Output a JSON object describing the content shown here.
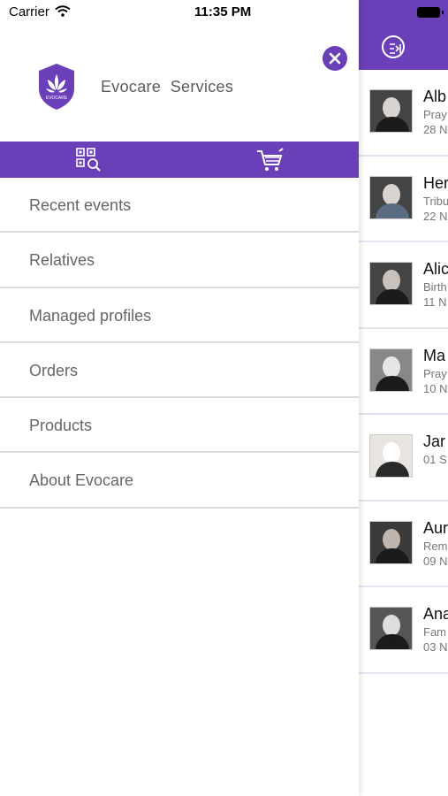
{
  "status_bar": {
    "carrier": "Carrier",
    "time": "11:35 PM"
  },
  "brand": {
    "name": "Evocare  Services",
    "logo_text": "EVOCARE"
  },
  "colors": {
    "accent": "#6a3fb8",
    "menu_text": "#666666",
    "divider": "#dcdcdc"
  },
  "action_bar": {
    "icons": [
      "qr-search-icon",
      "cart-icon"
    ]
  },
  "menu": {
    "items": [
      {
        "label": "Recent events"
      },
      {
        "label": "Relatives"
      },
      {
        "label": "Managed profiles"
      },
      {
        "label": "Orders"
      },
      {
        "label": "Products"
      },
      {
        "label": "About Evocare"
      }
    ]
  },
  "background_list": {
    "rows": [
      {
        "name": "Alb",
        "line1": "Pray",
        "line2": "28 N"
      },
      {
        "name": "Her",
        "line1": "Tribu",
        "line2": "22 N"
      },
      {
        "name": "Alic",
        "line1": "Birth",
        "line2": "11 N"
      },
      {
        "name": "Ma",
        "line1": "Pray",
        "line2": "10 N"
      },
      {
        "name": "Jar",
        "line1": "01 S",
        "line2": ""
      },
      {
        "name": "Aur",
        "line1": "Rem",
        "line2": "09 N"
      },
      {
        "name": "Ana",
        "line1": "Fam",
        "line2": "03 N"
      }
    ]
  }
}
